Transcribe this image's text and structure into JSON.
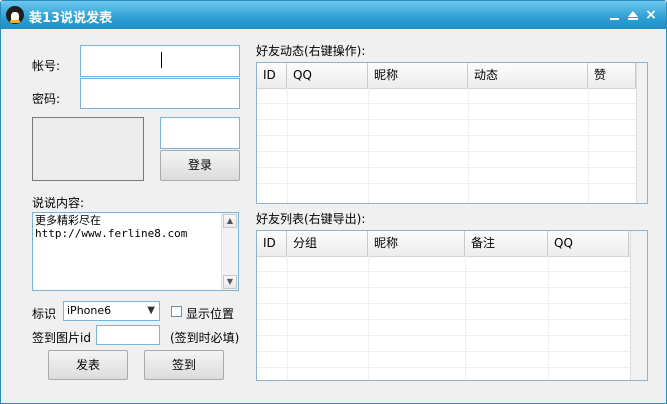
{
  "window": {
    "title": "装13说说发表",
    "buttons": {
      "minimize": "minimize-icon",
      "maximize": "maximize-icon",
      "close": "×"
    }
  },
  "login": {
    "account_label": "帐号:",
    "account_value": "",
    "password_label": "密码:",
    "password_value": "",
    "captcha_value": "",
    "login_button": "登录"
  },
  "compose": {
    "content_label": "说说内容:",
    "content_line1": "更多精彩尽在",
    "content_line2": "http://www.ferline8.com",
    "tag_label": "标识",
    "tag_selected": "iPhone6",
    "show_location_label": "显示位置",
    "checkin_image_label": "签到图片id",
    "checkin_image_value": "",
    "checkin_hint": "(签到时必填)",
    "publish_button": "发表",
    "checkin_button": "签到"
  },
  "friend_feed": {
    "title": "好友动态(右键操作):",
    "columns": [
      "ID",
      "QQ",
      "昵称",
      "动态",
      "赞"
    ]
  },
  "friend_list": {
    "title": "好友列表(右键导出):",
    "columns": [
      "ID",
      "分组",
      "昵称",
      "备注",
      "QQ"
    ]
  },
  "colors": {
    "titlebar": "#2e9fd4",
    "border": "#7ab3d6",
    "background": "#f0f0f0"
  }
}
